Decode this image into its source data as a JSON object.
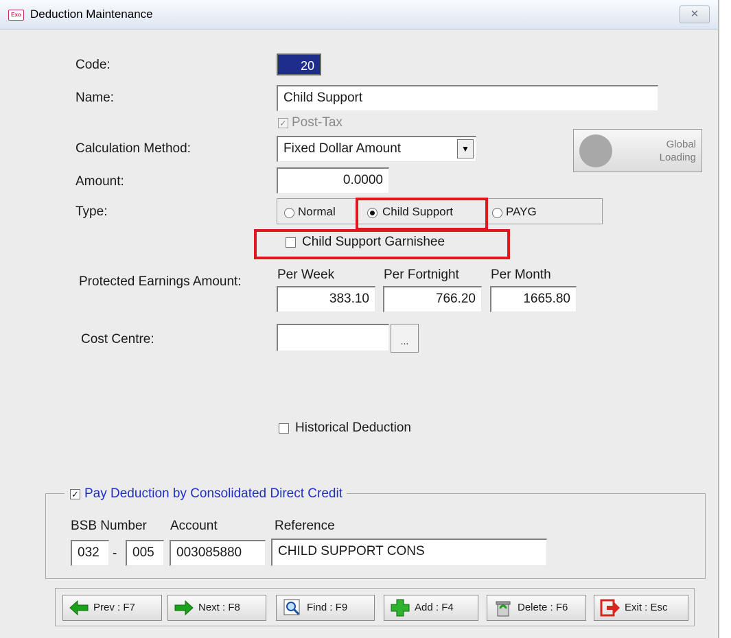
{
  "window": {
    "title": "Deduction Maintenance",
    "close_glyph": "✕",
    "app_icon": "Exo"
  },
  "form": {
    "code_label": "Code:",
    "code_value": "20",
    "name_label": "Name:",
    "name_value": "Child Support",
    "post_tax_label": "Post-Tax",
    "post_tax_checked": true,
    "calc_label": "Calculation Method:",
    "calc_value": "Fixed Dollar Amount",
    "amount_label": "Amount:",
    "amount_value": "0.0000",
    "type_label": "Type:",
    "type_options": [
      "Normal",
      "Child Support",
      "PAYG"
    ],
    "type_selected": "Child Support",
    "garnishee_label": "Child Support Garnishee",
    "garnishee_checked": false,
    "protected_label": "Protected Earnings Amount:",
    "per_week_label": "Per Week",
    "per_week_value": "383.10",
    "per_fortnight_label": "Per Fortnight",
    "per_fortnight_value": "766.20",
    "per_month_label": "Per Month",
    "per_month_value": "1665.80",
    "cost_centre_label": "Cost Centre:",
    "cost_centre_value": "",
    "cost_centre_button": "...",
    "historical_label": "Historical Deduction",
    "historical_checked": false
  },
  "global_loading": {
    "label_line1": "Global",
    "label_line2": "Loading"
  },
  "direct_credit": {
    "legend": "Pay Deduction by Consolidated Direct Credit",
    "checked": true,
    "bsb_label": "BSB Number",
    "account_label": "Account",
    "reference_label": "Reference",
    "bsb_part1": "032",
    "bsb_separator": "-",
    "bsb_part2": "005",
    "account_value": "003085880",
    "reference_value": "CHILD SUPPORT CONS"
  },
  "toolbar": {
    "prev": "Prev : F7",
    "next": "Next : F8",
    "find": "Find : F9",
    "add": "Add : F4",
    "delete": "Delete : F6",
    "exit": "Exit : Esc"
  },
  "colors": {
    "highlight_box": "#e0171e",
    "legend_text": "#1f2ec8",
    "code_bg": "#1e2d8a"
  }
}
